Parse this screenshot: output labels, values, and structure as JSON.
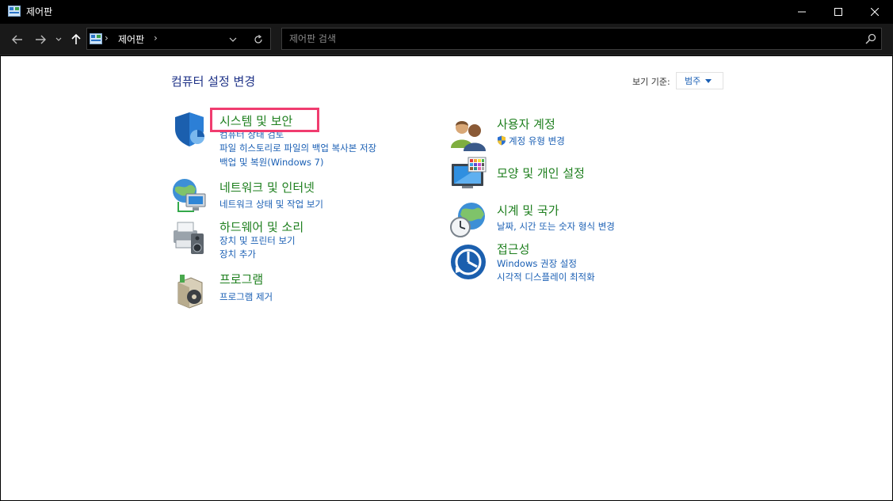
{
  "window": {
    "title": "제어판"
  },
  "address": {
    "crumb": "제어판",
    "separator": "›"
  },
  "search": {
    "placeholder": "제어판 검색"
  },
  "page": {
    "title": "컴퓨터 설정 변경",
    "view_by_label": "보기 기준:",
    "view_by_value": "범주"
  },
  "categories_left": [
    {
      "title": "시스템 및 보안",
      "links": [
        "컴퓨터 상태 검토",
        "파일 히스토리로 파일의 백업 복사본 저장",
        "백업 및 복원(Windows 7)"
      ]
    },
    {
      "title": "네트워크 및 인터넷",
      "links": [
        "네트워크 상태 및 작업 보기"
      ]
    },
    {
      "title": "하드웨어 및 소리",
      "links": [
        "장치 및 프린터 보기",
        "장치 추가"
      ]
    },
    {
      "title": "프로그램",
      "links": [
        "프로그램 제거"
      ]
    }
  ],
  "categories_right": [
    {
      "title": "사용자 계정",
      "links": [
        "계정 유형 변경"
      ]
    },
    {
      "title": "모양 및 개인 설정",
      "links": []
    },
    {
      "title": "시계 및 국가",
      "links": [
        "날짜, 시간 또는 숫자 형식 변경"
      ]
    },
    {
      "title": "접근성",
      "links": [
        "Windows 권장 설정",
        "시각적 디스플레이 최적화"
      ]
    }
  ],
  "colors": {
    "title_bar": "#000000",
    "category_title": "#1e7f1e",
    "link": "#1a5fb4",
    "highlight_border": "#f03c6f"
  }
}
